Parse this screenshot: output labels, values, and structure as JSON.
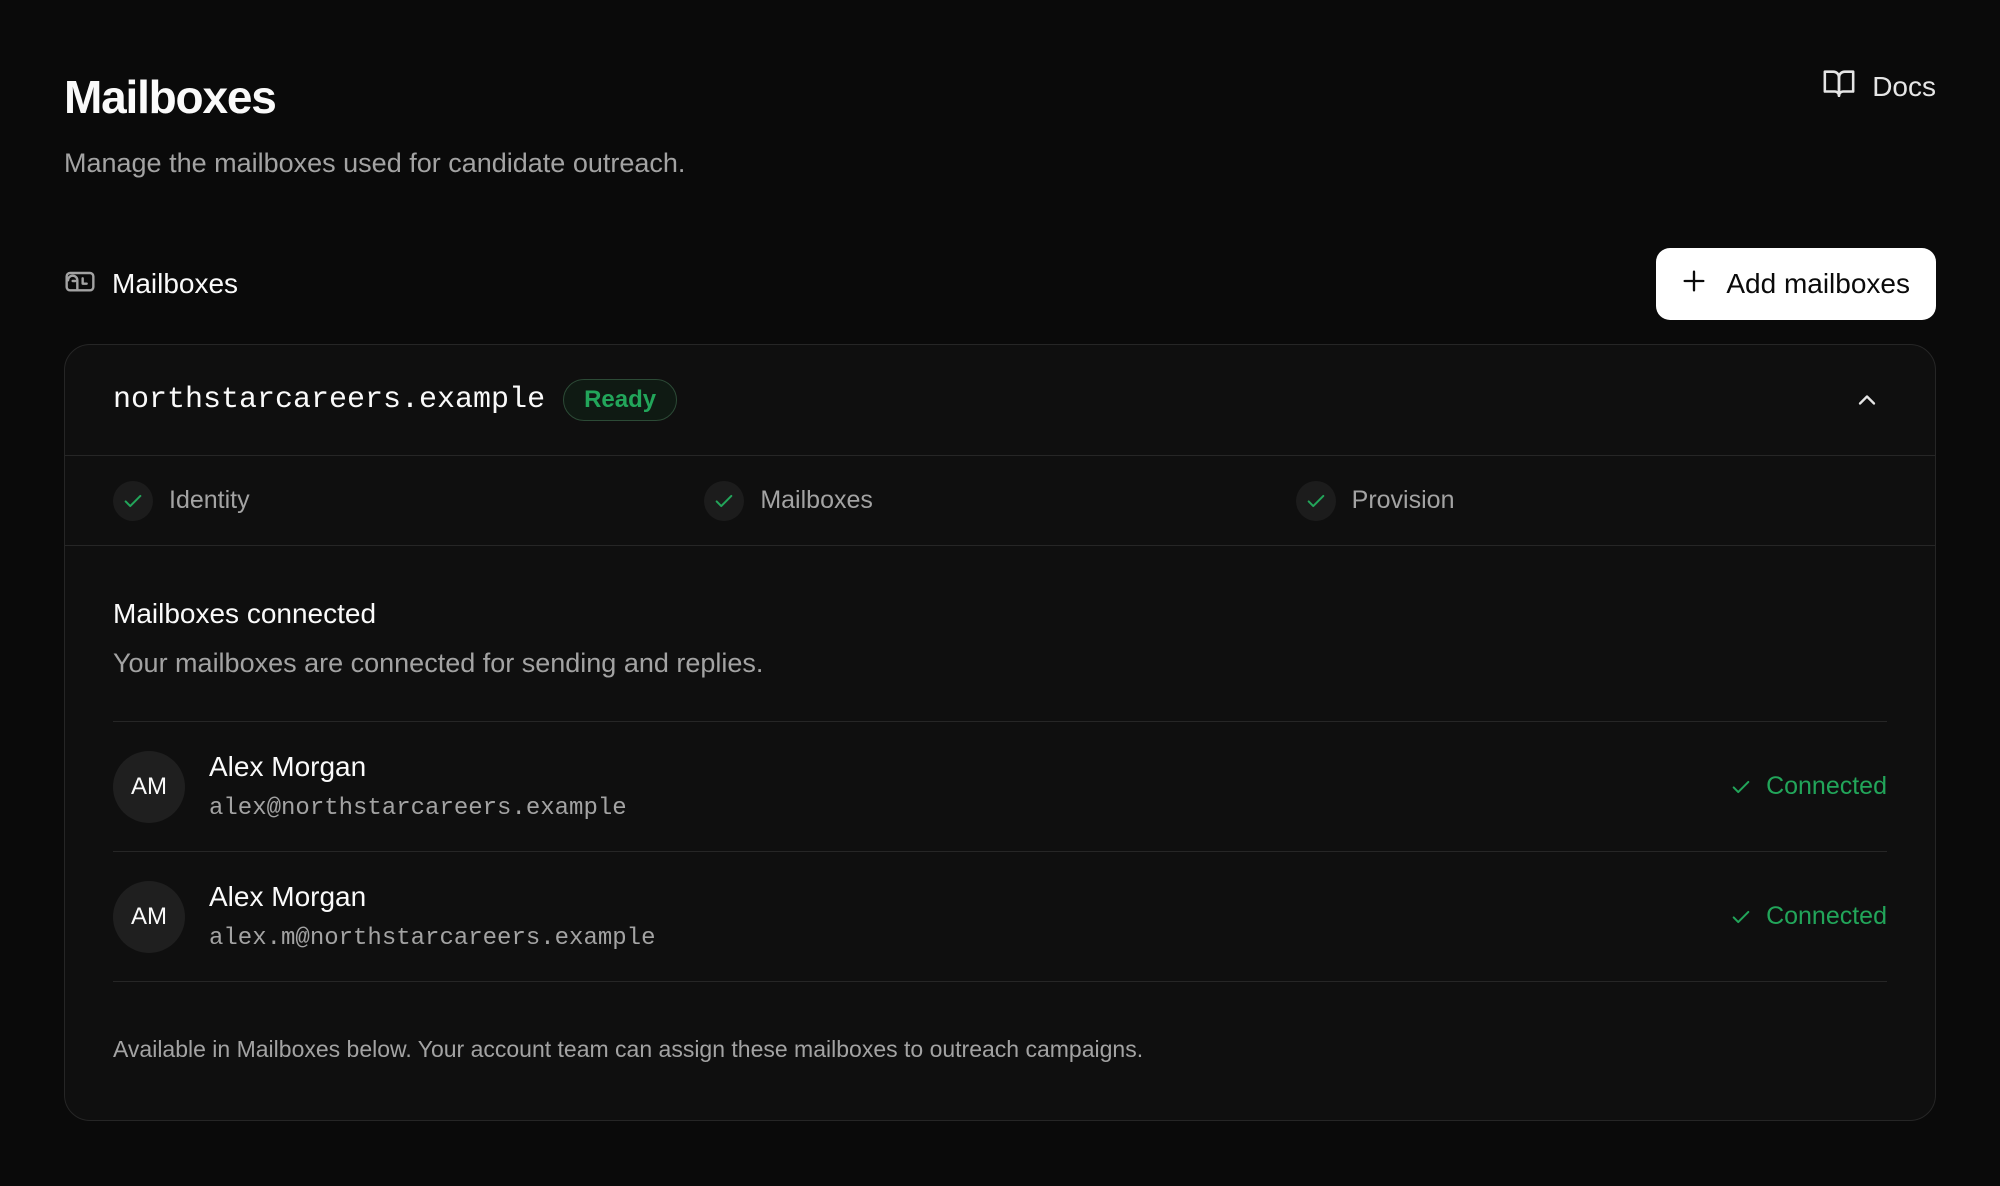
{
  "header": {
    "title": "Mailboxes",
    "subtitle": "Manage the mailboxes used for candidate outreach.",
    "docs_label": "Docs"
  },
  "section": {
    "title": "Mailboxes",
    "add_button_label": "Add mailboxes"
  },
  "domain_card": {
    "domain": "northstarcareers.example",
    "status": "Ready",
    "expanded": true,
    "steps": [
      {
        "label": "Identity",
        "complete": true
      },
      {
        "label": "Mailboxes",
        "complete": true
      },
      {
        "label": "Provision",
        "complete": true
      }
    ],
    "body_title": "Mailboxes connected",
    "body_description": "Your mailboxes are connected for sending and replies.",
    "mailboxes": [
      {
        "initials": "AM",
        "name": "Alex Morgan",
        "email": "alex@northstarcareers.example",
        "status": "Connected"
      },
      {
        "initials": "AM",
        "name": "Alex Morgan",
        "email": "alex.m@northstarcareers.example",
        "status": "Connected"
      }
    ],
    "footnote": "Available in Mailboxes below. Your account team can assign these mailboxes to outreach campaigns."
  },
  "colors": {
    "background": "#0a0a0a",
    "card": "#0f0f0f",
    "border": "#262626",
    "success": "#22a55a",
    "muted_text": "#a3a3a3",
    "primary_button": "#ffffff"
  },
  "icons": {
    "docs": "book-open-icon",
    "section": "mailbox-icon",
    "add": "plus-icon",
    "collapse": "chevron-up-icon",
    "step": "check-icon",
    "connected": "check-icon"
  }
}
